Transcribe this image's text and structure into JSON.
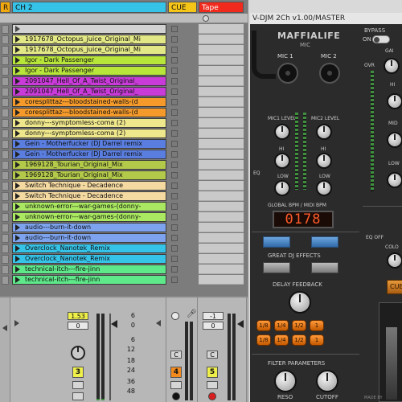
{
  "tracks": {
    "prev_label": "R",
    "ch2_label": "CH 2",
    "cue_label": "CUE",
    "tape_label": "Tape"
  },
  "clips": [
    {
      "name": "",
      "color": "#d2d2d2",
      "empty": true
    },
    {
      "name": "1917678_Octopus_juice_Original_Mi",
      "color": "#e3e886"
    },
    {
      "name": "1917678_Octopus_juice_Original_Mi",
      "color": "#e3e886"
    },
    {
      "name": "Igor - Dark Passenger",
      "color": "#b7e53a"
    },
    {
      "name": "Igor - Dark Passenger",
      "color": "#b7e53a"
    },
    {
      "name": "2091047_Hell_Of_A_Twist_Original_",
      "color": "#c93bd9"
    },
    {
      "name": "2091047_Hell_Of_A_Twist_Original_",
      "color": "#c93bd9"
    },
    {
      "name": "coresplittaz---bloodstained-walls-(d",
      "color": "#f59a2a"
    },
    {
      "name": "coresplittaz---bloodstained-walls-(d",
      "color": "#f59a2a"
    },
    {
      "name": "donny---symptomless-coma (2)",
      "color": "#efe78c"
    },
    {
      "name": "donny---symptomless-coma (2)",
      "color": "#efe78c"
    },
    {
      "name": "Gein - Motherfucker (DJ Darrel remix",
      "color": "#5a7ee0"
    },
    {
      "name": "Gein - Motherfucker (DJ Darrel remix",
      "color": "#5a7ee0"
    },
    {
      "name": "1969128_Tourian_Original_Mix",
      "color": "#b3c94a"
    },
    {
      "name": "1969128_Tourian_Original_Mix",
      "color": "#b3c94a"
    },
    {
      "name": "Switch Technique - Decadence",
      "color": "#f4d9a0"
    },
    {
      "name": "Switch Technique - Decadence",
      "color": "#f4d9a0"
    },
    {
      "name": "unknown-error---war-games-(donny-",
      "color": "#a9e860"
    },
    {
      "name": "unknown-error---war-games-(donny-",
      "color": "#a9e860"
    },
    {
      "name": "audio---burn-it-down",
      "color": "#7da3ee"
    },
    {
      "name": "audio---burn-it-down",
      "color": "#7da3ee"
    },
    {
      "name": "Overclock_Nanotek_Remix",
      "color": "#36c3e8"
    },
    {
      "name": "Overclock_Nanotek_Remix",
      "color": "#36c3e8"
    },
    {
      "name": "technical-itch---fire-jinn",
      "color": "#5fe88a"
    },
    {
      "name": "technical-itch---fire-jinn",
      "color": "#5fe88a"
    }
  ],
  "mixer": {
    "ch2": {
      "volume": "1.53",
      "pan": "0",
      "db_scale": [
        "6",
        "0",
        "6",
        "12",
        "18",
        "24",
        "36",
        "48"
      ],
      "track_number": "3"
    },
    "cue": {
      "track_number": "4",
      "button_label": "C"
    },
    "tape": {
      "volume": "-1",
      "pan": "0",
      "button_label": "C",
      "track_number": "5"
    }
  },
  "plugin": {
    "title": "V-DJM 2Ch v1.00/MASTER",
    "brand": "MAFFIALIFE",
    "brand_sub": "MIC",
    "bypass_label": "BYPASS",
    "on_label": "ON",
    "mic1": "MIC 1",
    "mic2": "MIC 2",
    "mic1_level": "MIC1 LEVEL",
    "mic2_level": "MIC2 LEVEL",
    "hi": "HI",
    "low": "LOW",
    "eq": "EQ",
    "global_bpm": "GLOBAL BPM / MIDI BPM",
    "bpm_value": "0178",
    "effects": "GREAT DJ EFFECTS",
    "delay_feedback": "DELAY FEEDBACK",
    "filter_params": "FILTER PARAMETERS",
    "reso": "RESO",
    "cutoff": "CUTOFF",
    "cue_btn": "CUE",
    "gain": "GAI",
    "hi2": "HI",
    "mid": "MID",
    "low2": "LOW",
    "eq_off": "EQ OFF",
    "color": "COLO",
    "ovr": "OVR",
    "made_by": "MADE BY"
  },
  "colors": {
    "orange_header": "#f2a80f",
    "cyan_header": "#36c3e8",
    "yellow_header": "#f5c518",
    "red_header": "#f02a1c",
    "display_text": "#ff5a2a"
  }
}
